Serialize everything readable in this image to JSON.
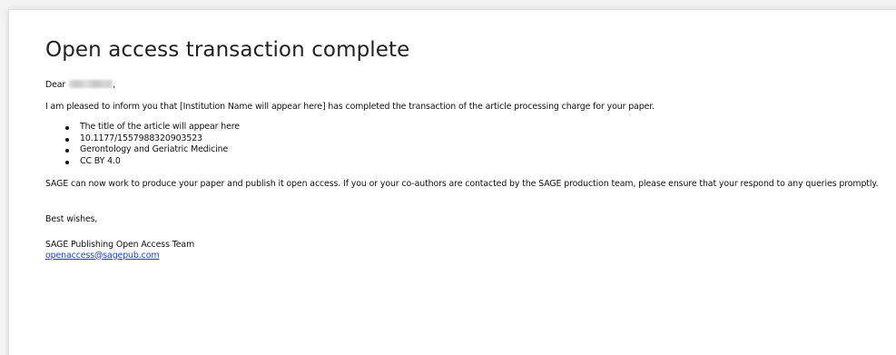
{
  "email": {
    "title": "Open access transaction complete",
    "greeting_prefix": "Dear",
    "greeting_suffix": ",",
    "intro": "I am pleased to inform you that [Institution Name will appear here] has completed the transaction of the article processing charge for your paper.",
    "details": [
      "The title of the article will appear here",
      "10.1177/1557988320903523",
      "Gerontology and Geriatric Medicine",
      "CC BY 4.0"
    ],
    "body": "SAGE can now work to produce your paper and publish it open access. If you or your co-authors are contacted by the SAGE production team, please ensure that your respond to any queries promptly.",
    "signoff": "Best wishes,",
    "team_name": "SAGE Publishing Open Access Team",
    "contact_email": "openaccess@sagepub.com"
  },
  "colors": {
    "link": "#1a3fd6",
    "text": "#111111",
    "background": "#ffffff"
  }
}
